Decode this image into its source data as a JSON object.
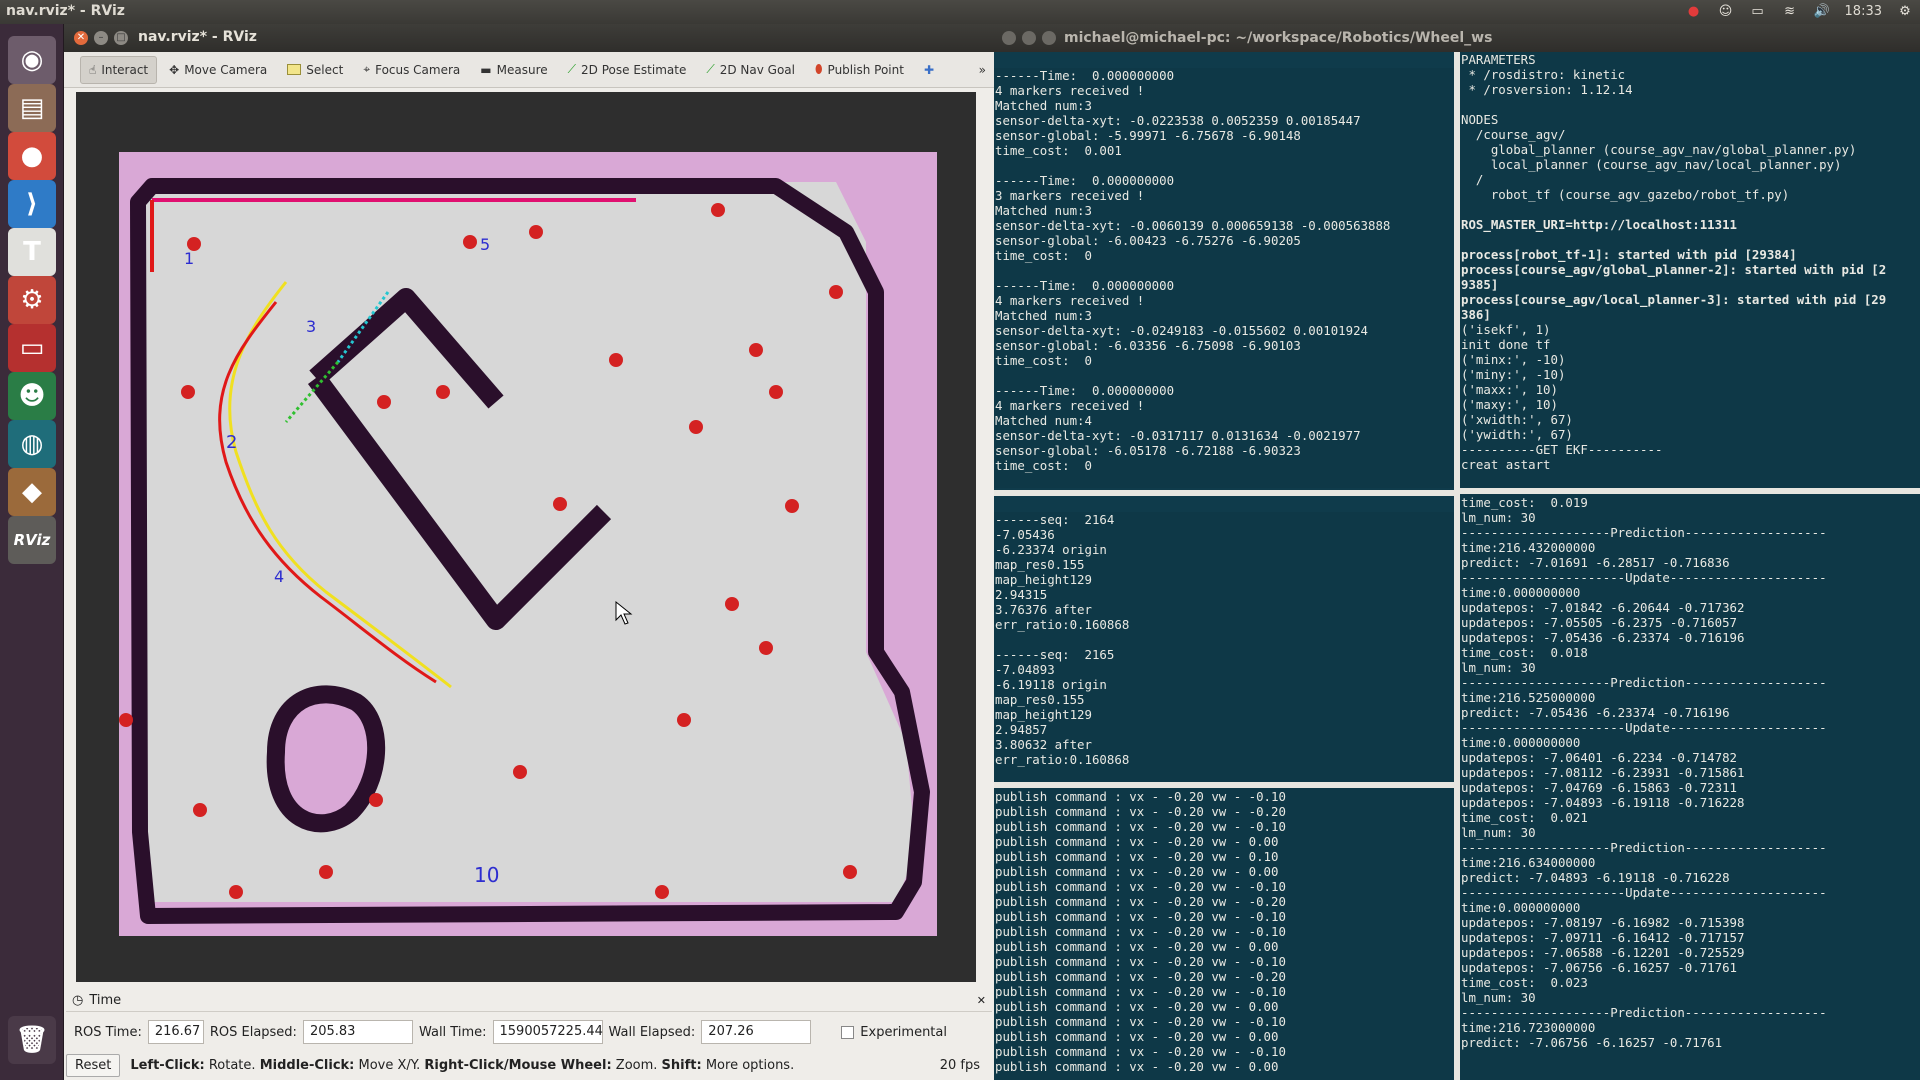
{
  "top_panel": {
    "title": "nav.rviz* - RViz",
    "clock": "18:33"
  },
  "launcher": {
    "items": [
      {
        "name": "dash-home",
        "glyph": "◉",
        "bg": "#6d5c6b"
      },
      {
        "name": "files",
        "glyph": "▤",
        "bg": "#8c6b56"
      },
      {
        "name": "chrome",
        "glyph": "●",
        "bg": "#d24b3c"
      },
      {
        "name": "vscode",
        "glyph": "⟩",
        "bg": "#2f7bc7"
      },
      {
        "name": "text-editor",
        "glyph": "T",
        "bg": "#e0e0dc"
      },
      {
        "name": "system-settings",
        "glyph": "⚙",
        "bg": "#c0463a"
      },
      {
        "name": "screen-recorder",
        "glyph": "▭",
        "bg": "#b5302f"
      },
      {
        "name": "panda",
        "glyph": "☻",
        "bg": "#2a7d46"
      },
      {
        "name": "globe",
        "glyph": "◍",
        "bg": "#1f6d7a"
      },
      {
        "name": "package",
        "glyph": "◆",
        "bg": "#9b6a3b"
      },
      {
        "name": "rviz",
        "glyph": "RViz",
        "bg": "#5e5c59"
      },
      {
        "name": "trash",
        "glyph": "🗑",
        "bg": "#4a3a48"
      }
    ]
  },
  "rviz": {
    "window_title": "nav.rviz* - RViz",
    "toolbar": {
      "interact": "Interact",
      "move_camera": "Move Camera",
      "select": "Select",
      "focus_camera": "Focus Camera",
      "measure": "Measure",
      "pose_estimate": "2D Pose Estimate",
      "nav_goal": "2D Nav Goal",
      "publish_point": "Publish Point",
      "more": "»"
    },
    "time_panel": {
      "header": "Time",
      "ros_time_label": "ROS Time:",
      "ros_time": "216.67",
      "ros_elapsed_label": "ROS Elapsed:",
      "ros_elapsed": "205.83",
      "wall_time_label": "Wall Time:",
      "wall_time": "1590057225.44",
      "wall_elapsed_label": "Wall Elapsed:",
      "wall_elapsed": "207.26",
      "experimental": "Experimental",
      "experimental_checked": false
    },
    "status": {
      "reset": "Reset",
      "left_click": "Left-Click:",
      "left_click_desc": "Rotate.",
      "middle_click": "Middle-Click:",
      "middle_click_desc": "Move X/Y.",
      "right_click": "Right-Click/Mouse Wheel:",
      "right_click_desc": "Zoom.",
      "shift": "Shift:",
      "shift_desc": "More options.",
      "fps": "20 fps"
    }
  },
  "terminal": {
    "title": "michael@michael-pc: ~/workspace/Robotics/Wheel_ws",
    "pane_top_left": [
      "------Time:  0.000000000",
      "4 markers received !",
      "Matched num:3",
      "sensor-delta-xyt: -0.0223538 0.0052359 0.00185447",
      "sensor-global: -5.99971 -6.75678 -6.90148",
      "time_cost:  0.001",
      "",
      "------Time:  0.000000000",
      "3 markers received !",
      "Matched num:3",
      "sensor-delta-xyt: -0.0060139 0.000659138 -0.000563888",
      "sensor-global: -6.00423 -6.75276 -6.90205",
      "time_cost:  0",
      "",
      "------Time:  0.000000000",
      "4 markers received !",
      "Matched num:3",
      "sensor-delta-xyt: -0.0249183 -0.0155602 0.00101924",
      "sensor-global: -6.03356 -6.75098 -6.90103",
      "time_cost:  0",
      "",
      "------Time:  0.000000000",
      "4 markers received !",
      "Matched num:4",
      "sensor-delta-xyt: -0.0317117 0.0131634 -0.0021977",
      "sensor-global: -6.05178 -6.72188 -6.90323",
      "time_cost:  0"
    ],
    "pane_top_right": [
      "PARAMETERS",
      " * /rosdistro: kinetic",
      " * /rosversion: 1.12.14",
      "",
      "NODES",
      "  /course_agv/",
      "    global_planner (course_agv_nav/global_planner.py)",
      "    local_planner (course_agv_nav/local_planner.py)",
      "  /",
      "    robot_tf (course_agv_gazebo/robot_tf.py)",
      "",
      "ROS_MASTER_URI=http://localhost:11311",
      "",
      "process[robot_tf-1]: started with pid [29384]",
      "process[course_agv/global_planner-2]: started with pid [2",
      "9385]",
      "process[course_agv/local_planner-3]: started with pid [29",
      "386]",
      "('isekf', 1)",
      "init done tf",
      "('minx:', -10)",
      "('miny:', -10)",
      "('maxx:', 10)",
      "('maxy:', 10)",
      "('xwidth:', 67)",
      "('ywidth:', 67)",
      "----------GET EKF----------",
      "creat astart"
    ],
    "pane_mid_left": [
      "------seq:  2164",
      "-7.05436",
      "-6.23374 origin",
      "map_res0.155",
      "map_height129",
      "2.94315",
      "3.76376 after",
      "err_ratio:0.160868",
      "",
      "------seq:  2165",
      "-7.04893",
      "-6.19118 origin",
      "map_res0.155",
      "map_height129",
      "2.94857",
      "3.80632 after",
      "err_ratio:0.160868"
    ],
    "pane_bottom_left": [
      "publish command : vx - -0.20 vw - -0.10",
      "publish command : vx - -0.20 vw - -0.20",
      "publish command : vx - -0.20 vw - -0.10",
      "publish command : vx - -0.20 vw - 0.00",
      "publish command : vx - -0.20 vw - 0.10",
      "publish command : vx - -0.20 vw - 0.00",
      "publish command : vx - -0.20 vw - -0.10",
      "publish command : vx - -0.20 vw - -0.20",
      "publish command : vx - -0.20 vw - -0.10",
      "publish command : vx - -0.20 vw - -0.10",
      "publish command : vx - -0.20 vw - 0.00",
      "publish command : vx - -0.20 vw - -0.10",
      "publish command : vx - -0.20 vw - -0.20",
      "publish command : vx - -0.20 vw - -0.10",
      "publish command : vx - -0.20 vw - 0.00",
      "publish command : vx - -0.20 vw - -0.10",
      "publish command : vx - -0.20 vw - 0.00",
      "publish command : vx - -0.20 vw - -0.10",
      "publish command : vx - -0.20 vw - 0.00"
    ],
    "pane_right_lower": [
      "time_cost:  0.019",
      "lm_num: 30",
      "--------------------Prediction-------------------",
      "time:216.432000000",
      "predict: -7.01691 -6.28517 -0.716836",
      "----------------------Update---------------------",
      "time:0.000000000",
      "updatepos: -7.01842 -6.20644 -0.717362",
      "updatepos: -7.05505 -6.2375 -0.716057",
      "updatepos: -7.05436 -6.23374 -0.716196",
      "time_cost:  0.018",
      "lm_num: 30",
      "--------------------Prediction-------------------",
      "time:216.525000000",
      "predict: -7.05436 -6.23374 -0.716196",
      "----------------------Update---------------------",
      "time:0.000000000",
      "updatepos: -7.06401 -6.2234 -0.714782",
      "updatepos: -7.08112 -6.23931 -0.715861",
      "updatepos: -7.04769 -6.15863 -0.72311",
      "updatepos: -7.04893 -6.19118 -0.716228",
      "time_cost:  0.021",
      "lm_num: 30",
      "--------------------Prediction-------------------",
      "time:216.634000000",
      "predict: -7.04893 -6.19118 -0.716228",
      "----------------------Update---------------------",
      "time:0.000000000",
      "updatepos: -7.08197 -6.16982 -0.715398",
      "updatepos: -7.09711 -6.16412 -0.717157",
      "updatepos: -7.06588 -6.12201 -0.725529",
      "updatepos: -7.06756 -6.16257 -0.71761",
      "time_cost:  0.023",
      "lm_num: 30",
      "--------------------Prediction-------------------",
      "time:216.723000000",
      "predict: -7.06756 -6.16257 -0.71761"
    ]
  },
  "colors": {
    "map_free": "#d7d7d7",
    "map_unknown": "#d9a8d6",
    "map_wall": "#2a0f2b",
    "landmark": "#d42222",
    "path_red": "#e01818",
    "path_yellow": "#f0e020"
  }
}
